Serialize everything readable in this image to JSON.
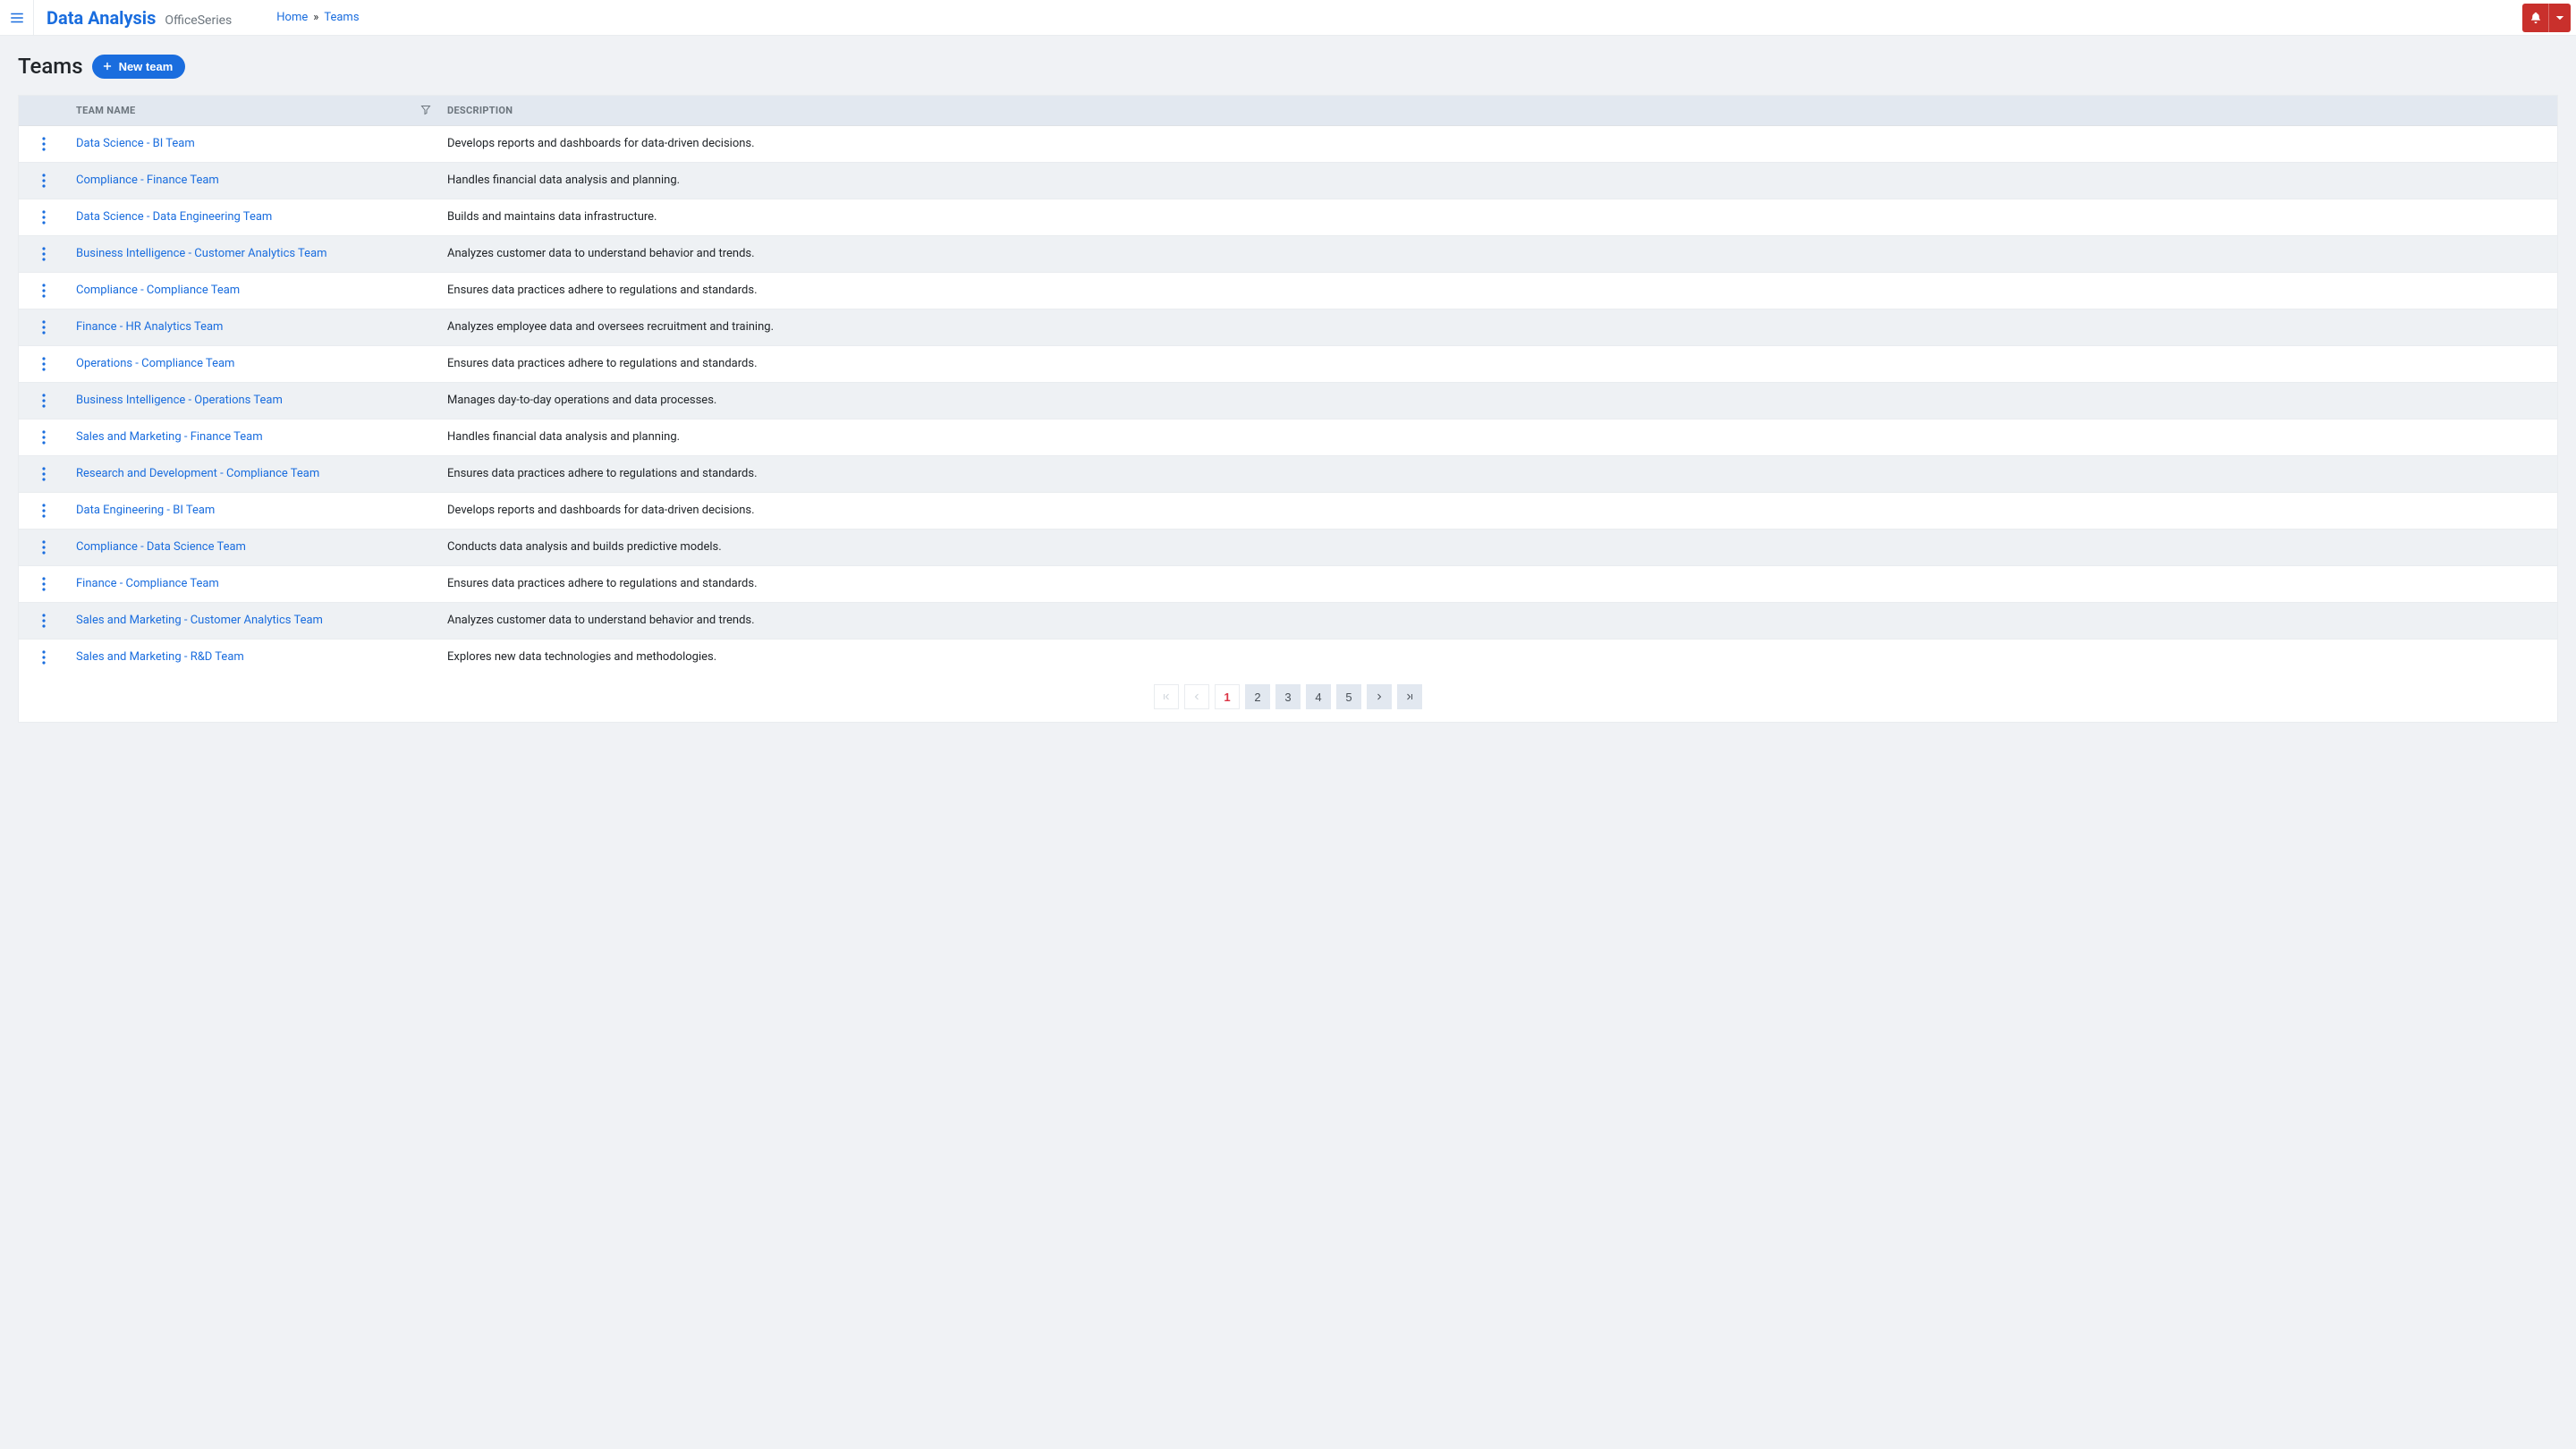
{
  "header": {
    "brand_title": "Data Analysis",
    "brand_sub": "OfficeSeries"
  },
  "breadcrumb": {
    "home": "Home",
    "sep": "»",
    "current": "Teams"
  },
  "page": {
    "title": "Teams",
    "new_button": "New team"
  },
  "table": {
    "columns": {
      "name": "Team Name",
      "description": "Description"
    },
    "rows": [
      {
        "name": "Data Science - BI Team",
        "description": "Develops reports and dashboards for data-driven decisions."
      },
      {
        "name": "Compliance - Finance Team",
        "description": "Handles financial data analysis and planning."
      },
      {
        "name": "Data Science - Data Engineering Team",
        "description": "Builds and maintains data infrastructure."
      },
      {
        "name": "Business Intelligence - Customer Analytics Team",
        "description": "Analyzes customer data to understand behavior and trends."
      },
      {
        "name": "Compliance - Compliance Team",
        "description": "Ensures data practices adhere to regulations and standards."
      },
      {
        "name": "Finance - HR Analytics Team",
        "description": "Analyzes employee data and oversees recruitment and training."
      },
      {
        "name": "Operations - Compliance Team",
        "description": "Ensures data practices adhere to regulations and standards."
      },
      {
        "name": "Business Intelligence - Operations Team",
        "description": "Manages day-to-day operations and data processes."
      },
      {
        "name": "Sales and Marketing - Finance Team",
        "description": "Handles financial data analysis and planning."
      },
      {
        "name": "Research and Development - Compliance Team",
        "description": "Ensures data practices adhere to regulations and standards."
      },
      {
        "name": "Data Engineering - BI Team",
        "description": "Develops reports and dashboards for data-driven decisions."
      },
      {
        "name": "Compliance - Data Science Team",
        "description": "Conducts data analysis and builds predictive models."
      },
      {
        "name": "Finance - Compliance Team",
        "description": "Ensures data practices adhere to regulations and standards."
      },
      {
        "name": "Sales and Marketing - Customer Analytics Team",
        "description": "Analyzes customer data to understand behavior and trends."
      },
      {
        "name": "Sales and Marketing - R&D Team",
        "description": "Explores new data technologies and methodologies."
      }
    ]
  },
  "pagination": {
    "pages": [
      "1",
      "2",
      "3",
      "4",
      "5"
    ],
    "active": "1"
  }
}
